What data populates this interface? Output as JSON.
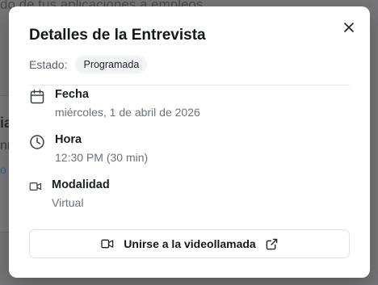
{
  "background": {
    "header_text": "do de tus aplicaciones a empleos",
    "fragment_1": "ia",
    "fragment_2": "nn",
    "fragment_3": "o"
  },
  "modal": {
    "title": "Detalles de la Entrevista",
    "status_label": "Estado:",
    "status_value": "Programada",
    "details": [
      {
        "icon": "calendar-icon",
        "label": "Fecha",
        "value": "miércoles, 1 de abril de 2026"
      },
      {
        "icon": "clock-icon",
        "label": "Hora",
        "value": "12:30 PM (30 min)"
      },
      {
        "icon": "video-icon",
        "label": "Modalidad",
        "value": "Virtual"
      }
    ],
    "join_button_label": "Unirse a la videollamada"
  }
}
